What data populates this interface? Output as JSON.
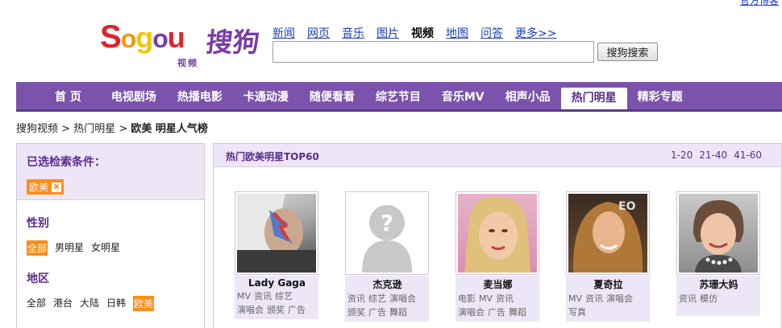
{
  "top_link": "官方博客",
  "logo": {
    "word": "Sogou",
    "cn": "搜狗",
    "sub": "视频"
  },
  "search_nav": [
    {
      "label": "新闻",
      "current": false
    },
    {
      "label": "网页",
      "current": false
    },
    {
      "label": "音乐",
      "current": false
    },
    {
      "label": "图片",
      "current": false
    },
    {
      "label": "视频",
      "current": true
    },
    {
      "label": "地图",
      "current": false
    },
    {
      "label": "问答",
      "current": false
    },
    {
      "label": "更多>>",
      "current": false
    }
  ],
  "search": {
    "value": "",
    "button": "搜狗搜索"
  },
  "channels": [
    {
      "label": "首 页",
      "current": false
    },
    {
      "label": "电视剧场",
      "current": false
    },
    {
      "label": "热播电影",
      "current": false
    },
    {
      "label": "卡通动漫",
      "current": false
    },
    {
      "label": "随便看看",
      "current": false
    },
    {
      "label": "综艺节目",
      "current": false
    },
    {
      "label": "音乐MV",
      "current": false
    },
    {
      "label": "相声小品",
      "current": false
    },
    {
      "label": "热门明星",
      "current": true
    },
    {
      "label": "精彩专题",
      "current": false
    }
  ],
  "breadcrumb": {
    "c1": "搜狗视频",
    "sep1": " > ",
    "c2": "热门明星",
    "sep2": " > ",
    "c3": "欧美 明星人气榜"
  },
  "filter": {
    "selected_title": "已选检索条件：",
    "selected_tag": "欧美",
    "gender": {
      "title": "性别",
      "options": [
        "全部",
        "男明星",
        "女明星"
      ],
      "active": 0
    },
    "region": {
      "title": "地区",
      "options": [
        "全部",
        "港台",
        "大陆",
        "日韩",
        "欧美"
      ],
      "active": 4
    }
  },
  "main": {
    "title": "热门欧美明星TOP60",
    "pages": [
      "1-20",
      "21-40",
      "41-60"
    ],
    "stars": [
      {
        "name": "Lady Gaga",
        "photo": "lady-gaga-photo",
        "links": [
          "MV",
          "资讯",
          "综艺",
          "演唱会",
          "颁奖",
          "广告"
        ]
      },
      {
        "name": "杰克逊",
        "photo": "placeholder-avatar",
        "links": [
          "资讯",
          "综艺",
          "演唱会",
          "颁奖",
          "广告",
          "舞蹈"
        ]
      },
      {
        "name": "麦当娜",
        "photo": "madonna-photo",
        "links": [
          "电影",
          "MV",
          "资讯",
          "演唱会",
          "广告",
          "舞蹈"
        ]
      },
      {
        "name": "夏奇拉",
        "photo": "shakira-photo",
        "links": [
          "MV",
          "资讯",
          "演唱会",
          "写真"
        ]
      },
      {
        "name": "苏珊大妈",
        "photo": "susan-boyle-photo",
        "links": [
          "资讯",
          "模仿"
        ]
      }
    ]
  }
}
